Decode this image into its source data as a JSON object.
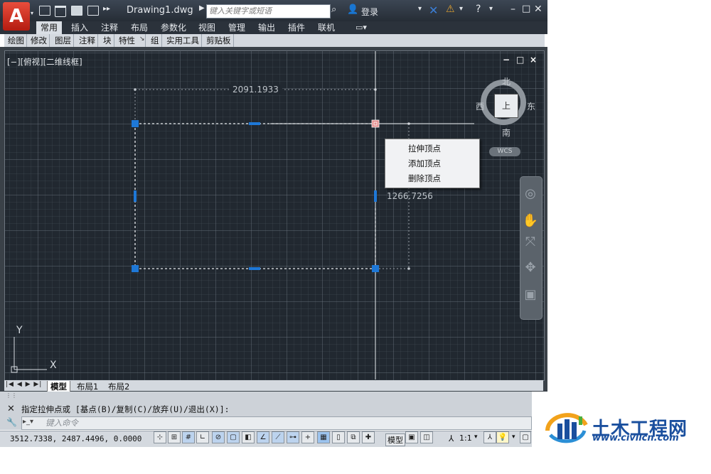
{
  "app": {
    "title": "Drawing1.dwg",
    "logo_letter": "A",
    "search_placeholder": "键入关键字或短语",
    "login": "登录"
  },
  "ribbon": {
    "tabs": [
      "常用",
      "插入",
      "注释",
      "布局",
      "参数化",
      "视图",
      "管理",
      "输出",
      "插件",
      "联机"
    ],
    "active_tab": "常用",
    "panels": [
      "绘图",
      "修改",
      "图层",
      "注释",
      "块",
      "特性",
      "组",
      "实用工具",
      "剪贴板"
    ]
  },
  "viewport": {
    "label": "[−][俯视][二维线框]",
    "controls": [
      "−",
      "□",
      "×"
    ],
    "dim_horizontal": "2091.1933",
    "dim_vertical": "1266.7256",
    "background_color": "#212830",
    "grip_color": "#1e78d7"
  },
  "context_menu": {
    "items": [
      "拉伸顶点",
      "添加顶点",
      "删除顶点"
    ]
  },
  "viewcube": {
    "north": "北",
    "south": "南",
    "east": "东",
    "west": "西",
    "face": "上",
    "wcs": "WCS"
  },
  "ucs": {
    "x": "X",
    "y": "Y"
  },
  "layout_tabs": [
    "模型",
    "布局1",
    "布局2"
  ],
  "command": {
    "history": "指定拉伸点或 [基点(B)/复制(C)/放弃(U)/退出(X)]:",
    "placeholder": "键入命令"
  },
  "status": {
    "coords": "3512.7338, 2487.4496, 0.0000",
    "model": "模型",
    "scale": "1:1"
  },
  "watermark": {
    "name": "土木工程网",
    "url": "www.civilcn.com"
  }
}
